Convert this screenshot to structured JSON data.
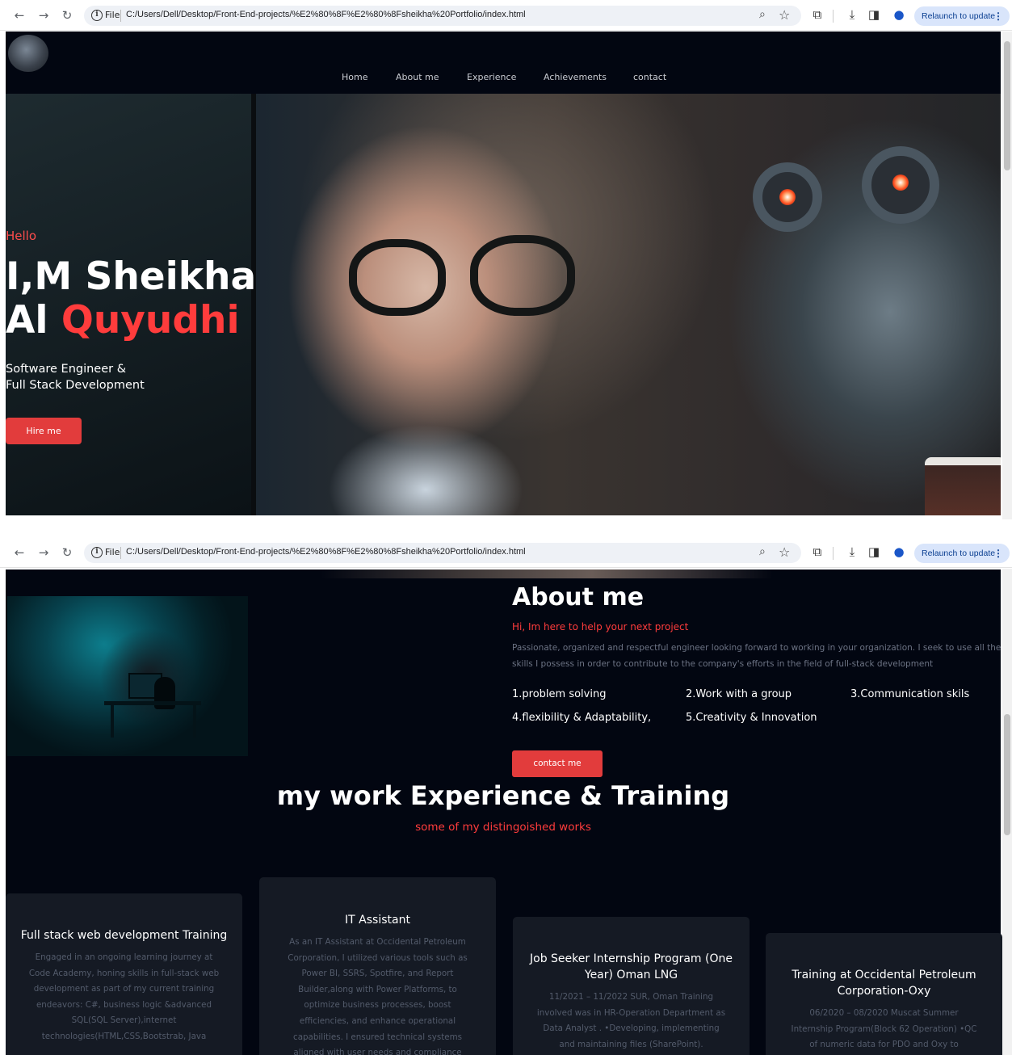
{
  "browser": {
    "scheme_label": "File",
    "url": "C:/Users/Dell/Desktop/Front-End-projects/%E2%80%8F%E2%80%8Fsheikha%20Portfolio/index.html",
    "relaunch_label": "Relaunch to update",
    "icons": [
      "back-icon",
      "forward-icon",
      "reload-icon",
      "info-icon",
      "zoom-icon",
      "star-icon",
      "extensions-icon",
      "download-icon",
      "sidepanel-icon",
      "profile-icon",
      "menu-dots-icon"
    ]
  },
  "nav": {
    "items": [
      "Home",
      "About me",
      "Experience",
      "Achievements",
      "contact"
    ]
  },
  "hero": {
    "greeting": "Hello",
    "name_line1": "I,M Sheikha",
    "name_line2_a": "Al ",
    "name_line2_b": "Quyudhi",
    "role_line1": "Software Engineer &",
    "role_line2": "Full Stack Development",
    "hire_label": "Hire me"
  },
  "about": {
    "title": "About me",
    "subtitle": "Hi, Im here to help your next project",
    "text": "Passionate, organized and respectful engineer looking forward to working in your organization. I seek to use all the skills I possess in order to contribute to the company's efforts in the field of full-stack development",
    "skills": [
      "1.problem solving",
      "2.Work with a group",
      "3.Communication skils",
      "4.flexibility & Adaptability,",
      "5.Creativity & Innovation"
    ],
    "contact_label": "contact me"
  },
  "experience": {
    "title": "my work Experience & Training",
    "subtitle": "some of my distingoished works",
    "cards": [
      {
        "title": "Full stack web development Training",
        "text": "Engaged in an ongoing learning journey at Code Academy, honing skills in full-stack web development as part of my current training endeavors: C#, business logic &advanced SQL(SQL Server),internet technologies(HTML,CSS,Bootstrab, Java"
      },
      {
        "title": "IT Assistant",
        "text": "As an IT Assistant at Occidental Petroleum Corporation, I utilized various tools such as Power BI, SSRS, Spotfire, and Report Builder,along with Power Platforms, to optimize business processes, boost efficiencies, and enhance operational capabilities. I ensured technical systems aligned with user needs and compliance"
      },
      {
        "title": "Job Seeker Internship Program (One Year) Oman LNG",
        "text": "11/2021 – 11/2022 SUR, Oman Training involved was in HR-Operation Department as Data Analyst . •Developing, implementing and maintaining files (SharePoint)."
      },
      {
        "title": "Training at Occidental Petroleum Corporation-Oxy",
        "text": "06/2020 – 08/2020 Muscat Summer Internship Program(Block 62 Operation) •QC of numeric data for PDO and Oxy to"
      }
    ]
  }
}
